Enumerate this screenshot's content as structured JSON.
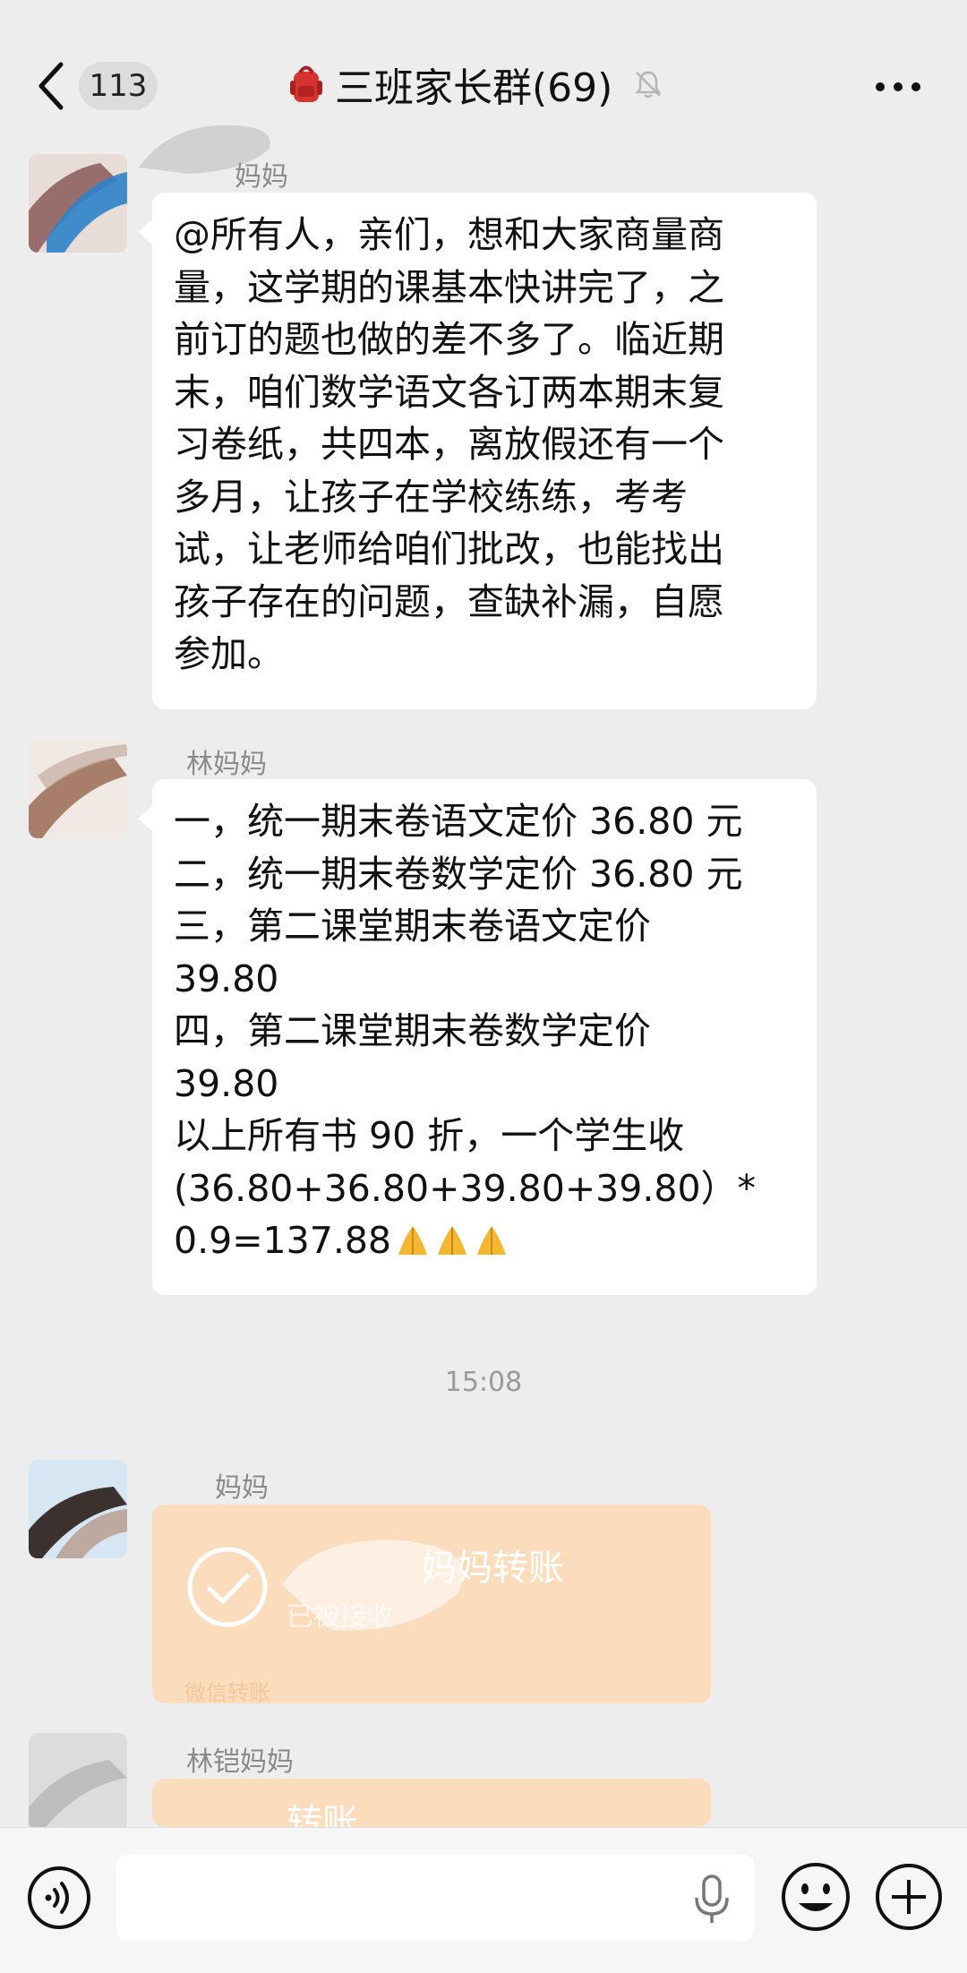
{
  "header": {
    "unread_count": "113",
    "title": "三班家长群(69)"
  },
  "messages": [
    {
      "sender": "妈妈",
      "text": "@所有人，亲们，想和大家商量商\n量，这学期的课基本快讲完了，之\n前订的题也做的差不多了。临近期\n末，咱们数学语文各订两本期末复\n习卷纸，共四本，离放假还有一个\n多月，让孩子在学校练练，考考\n试，让老师给咱们批改，也能找出\n孩子存在的问题，查缺补漏，自愿\n参加。"
    },
    {
      "sender": "林妈妈",
      "lines": [
        "一，统一期末卷语文定价 36.80 元",
        "二，统一期末卷数学定价 36.80 元",
        "三，第二课堂期末卷语文定价",
        "39.80",
        "四，第二课堂期末卷数学定价",
        "39.80",
        "以上所有书 90 折，一个学生收",
        "(36.80+36.80+39.80+39.80）*",
        "0.9=137.88"
      ],
      "emoji": "folded-hands-emoji"
    }
  ],
  "timestamp": "15:08",
  "transfers": [
    {
      "sender": "妈妈",
      "title": "妈妈转账",
      "status": "已被接收",
      "footer": "微信转账"
    },
    {
      "sender": "林铠妈妈",
      "title": "转账"
    }
  ],
  "colors": {
    "background": "#ededed",
    "bubble": "#ffffff",
    "transfer": "#fbdcbd",
    "text_secondary": "#8a8a8a"
  }
}
